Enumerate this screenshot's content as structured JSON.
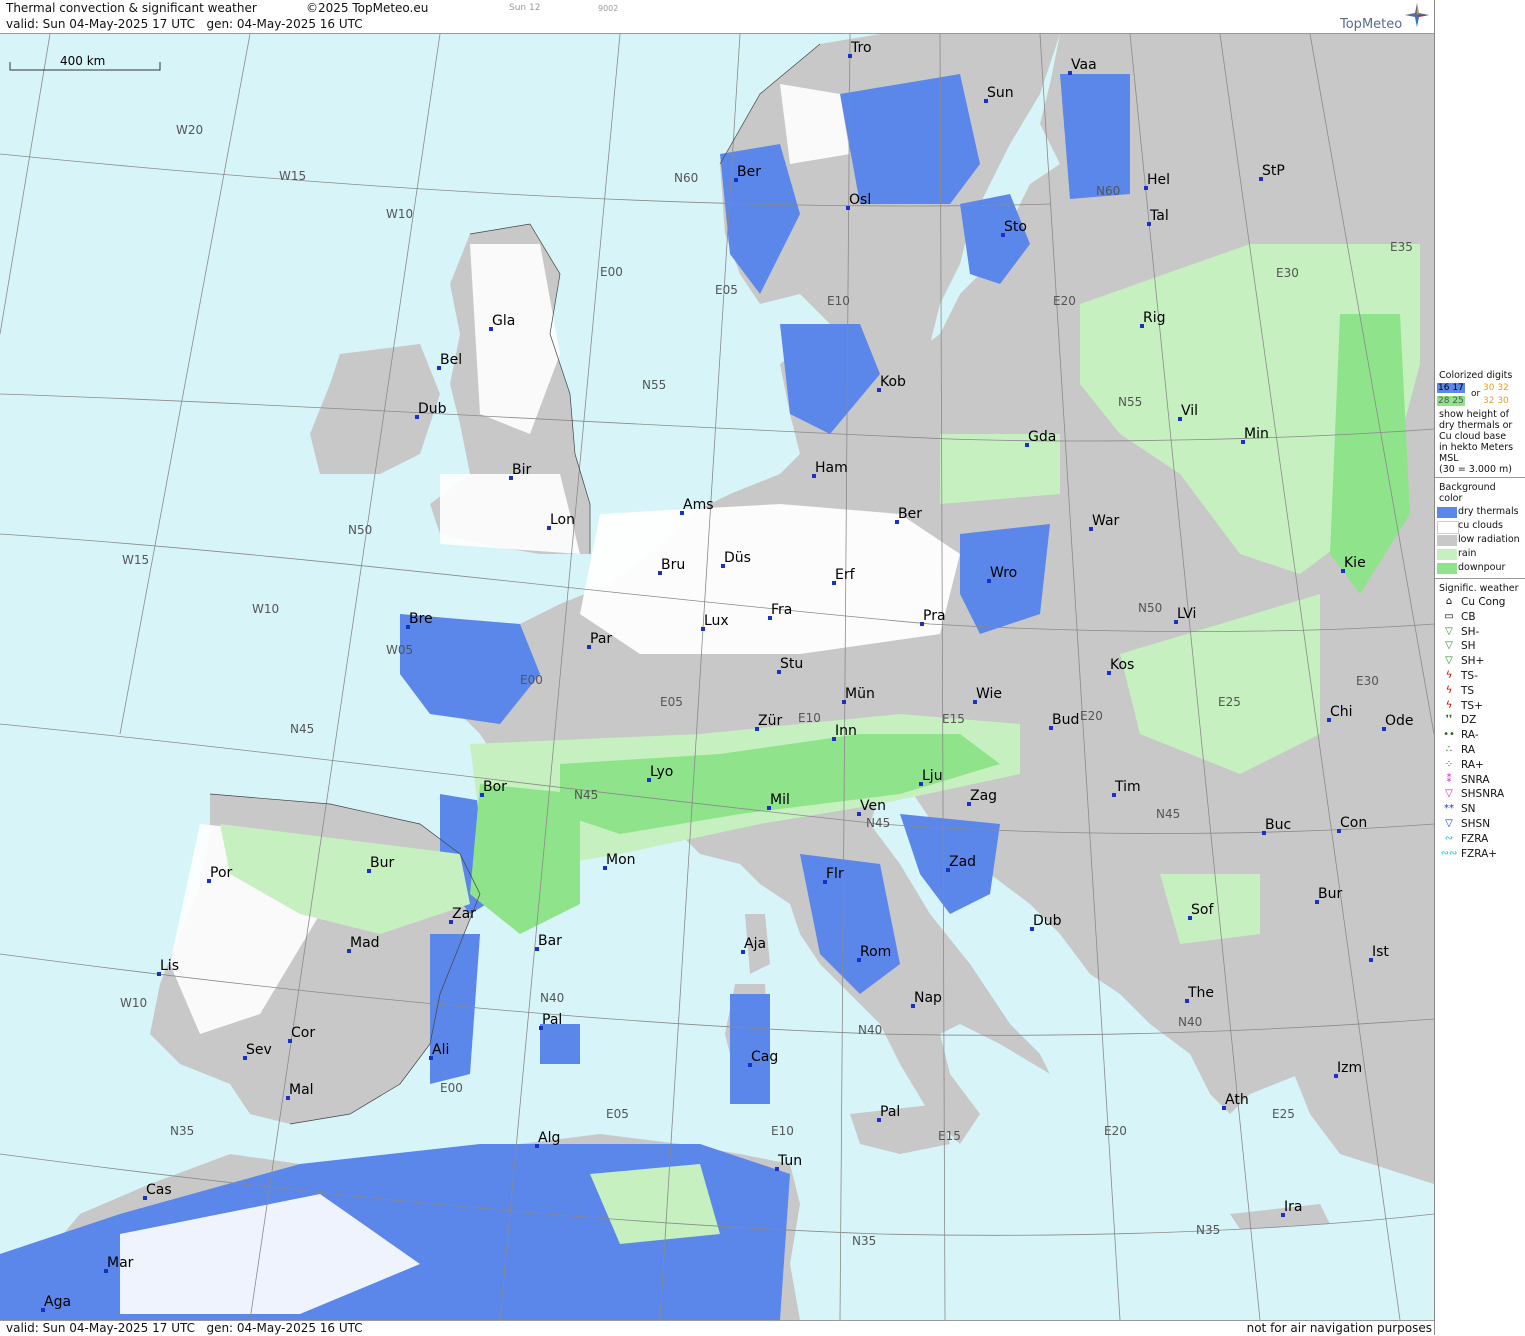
{
  "header": {
    "title": "Thermal convection & significant weather",
    "copyright": "©2025 TopMeteo.eu",
    "run_label": "Sun 12",
    "code_label": "9002",
    "valid_text": "valid:  Sun  04-May-2025  17 UTC",
    "gen_text": "gen: 04-May-2025 16 UTC",
    "logo": "TopMeteo"
  },
  "footer": {
    "valid_text": "valid:  Sun  04-May-2025  17 UTC",
    "gen_text": "gen: 04-May-2025 16 UTC",
    "disclaimer": "not for air navigation purposes"
  },
  "scale": {
    "label": "400 km"
  },
  "grid_labels": {
    "meridians": [
      "W20",
      "W15",
      "W10",
      "E00",
      "E05",
      "E10",
      "E20",
      "E30",
      "E35",
      "W15",
      "W10",
      "W05",
      "E00",
      "E05",
      "E10",
      "E15",
      "E20",
      "E25",
      "E30",
      "W10",
      "E00",
      "E05",
      "E10",
      "E15",
      "E20",
      "E25"
    ],
    "parallels": [
      "N60",
      "N60",
      "N55",
      "N55",
      "N50",
      "N50",
      "N45",
      "N45",
      "N45",
      "N45",
      "N40",
      "N40",
      "N40",
      "N35",
      "N35",
      "N35"
    ]
  },
  "cities": [
    "Tro",
    "Vaa",
    "Sun",
    "Ber",
    "Osl",
    "Hel",
    "StP",
    "Tal",
    "Sto",
    "Rig",
    "Gla",
    "Bel",
    "Kob",
    "Dub",
    "Vil",
    "Min",
    "Gda",
    "Ham",
    "Bir",
    "Ams",
    "Lon",
    "Ber",
    "War",
    "Bru",
    "Düs",
    "Erf",
    "Wro",
    "Kie",
    "Bre",
    "Lux",
    "Fra",
    "Par",
    "Pra",
    "LVi",
    "Stu",
    "Kos",
    "Mün",
    "Wie",
    "Chi",
    "Ode",
    "Zür",
    "Inn",
    "Bud",
    "Lyo",
    "Lju",
    "Bor",
    "Mil",
    "Zag",
    "Tim",
    "Ven",
    "Buc",
    "Con",
    "Mon",
    "Bur",
    "Por",
    "Flr",
    "Zad",
    "Sof",
    "Bur",
    "Zar",
    "Dub",
    "Aja",
    "Mad",
    "Bar",
    "Rom",
    "Ist",
    "Lis",
    "Nap",
    "The",
    "Pal",
    "Cor",
    "Cag",
    "Ali",
    "Sev",
    "Izm",
    "Mal",
    "Ath",
    "Pal",
    "Alg",
    "Tun",
    "Ira",
    "Cas",
    "Mar",
    "Aga"
  ],
  "legend": {
    "colorized_title": "Colorized digits",
    "colorized_lines": [
      "show height of",
      "dry thermals or",
      "Cu cloud base",
      "in hekto Meters",
      "MSL",
      "(30 = 3.000 m)"
    ],
    "digits_a": "16 17",
    "digits_b": "28 25",
    "digits_or": "or",
    "digits_c": "30 32",
    "digits_d": "32 30",
    "background_title": "Background color",
    "background_items": [
      {
        "label": "dry thermals",
        "color": "#5b86ea"
      },
      {
        "label": "cu clouds",
        "color": "#ffffff"
      },
      {
        "label": "low radiation",
        "color": "#c8c8c8"
      },
      {
        "label": "rain",
        "color": "#c6f0c0"
      },
      {
        "label": "downpour",
        "color": "#8fe38a"
      }
    ],
    "sigwx_title": "Signific. weather",
    "sigwx_items": [
      {
        "symbol": "⌂",
        "label": "Cu Cong",
        "color": "#000000"
      },
      {
        "symbol": "▭",
        "label": "CB",
        "color": "#000000"
      },
      {
        "symbol": "▽",
        "label": "SH-",
        "color": "#2e8b2e"
      },
      {
        "symbol": "▽",
        "label": "SH",
        "color": "#2e8b2e"
      },
      {
        "symbol": "▽",
        "label": "SH+",
        "color": "#2e8b2e"
      },
      {
        "symbol": "ϟ",
        "label": "TS-",
        "color": "#cc0000"
      },
      {
        "symbol": "ϟ",
        "label": "TS",
        "color": "#cc0000"
      },
      {
        "symbol": "ϟ",
        "label": "TS+",
        "color": "#cc0000"
      },
      {
        "symbol": "❜❜",
        "label": "DZ",
        "color": "#1a6b1a"
      },
      {
        "symbol": "••",
        "label": "RA-",
        "color": "#1a6b1a"
      },
      {
        "symbol": "∴",
        "label": "RA",
        "color": "#1a6b1a"
      },
      {
        "symbol": "⁘",
        "label": "RA+",
        "color": "#1a6b1a"
      },
      {
        "symbol": "⁑",
        "label": "SNRA",
        "color": "#cc22cc"
      },
      {
        "symbol": "▽",
        "label": "SHSNRA",
        "color": "#cc22cc"
      },
      {
        "symbol": "**",
        "label": "SN",
        "color": "#2233cc"
      },
      {
        "symbol": "▽",
        "label": "SHSN",
        "color": "#2233cc"
      },
      {
        "symbol": "∾",
        "label": "FZRA",
        "color": "#22bbdd"
      },
      {
        "symbol": "∾∾",
        "label": "FZRA+",
        "color": "#22bbdd"
      }
    ]
  }
}
